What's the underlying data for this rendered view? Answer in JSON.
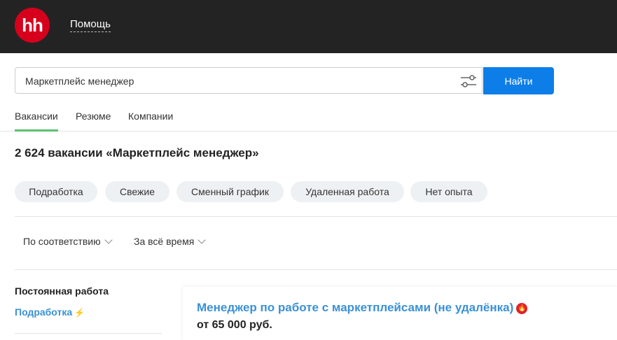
{
  "header": {
    "logo": "hh",
    "help": "Помощь"
  },
  "search": {
    "value": "Маркетплейс менеджер",
    "button": "Найти"
  },
  "tabs": [
    {
      "label": "Вакансии",
      "active": true
    },
    {
      "label": "Резюме"
    },
    {
      "label": "Компании"
    }
  ],
  "results": {
    "title": "2 624 вакансии «Маркетплейс менеджер»"
  },
  "chips": [
    "Подработка",
    "Свежие",
    "Сменный график",
    "Удаленная работа",
    "Нет опыта"
  ],
  "sort": {
    "order": "По соответствию",
    "period": "За всё время"
  },
  "sidebar": {
    "heading": "Постоянная работа",
    "link": "Подработка"
  },
  "vacancy": {
    "title": "Менеджер по работе с маркетплейсами (не удалёнка)",
    "salary": "от 65 000 руб."
  },
  "colors": {
    "accent": "#0d7ee8",
    "link": "#3a91d6",
    "logo": "#d6001c",
    "tab_active": "#5dbf74"
  }
}
